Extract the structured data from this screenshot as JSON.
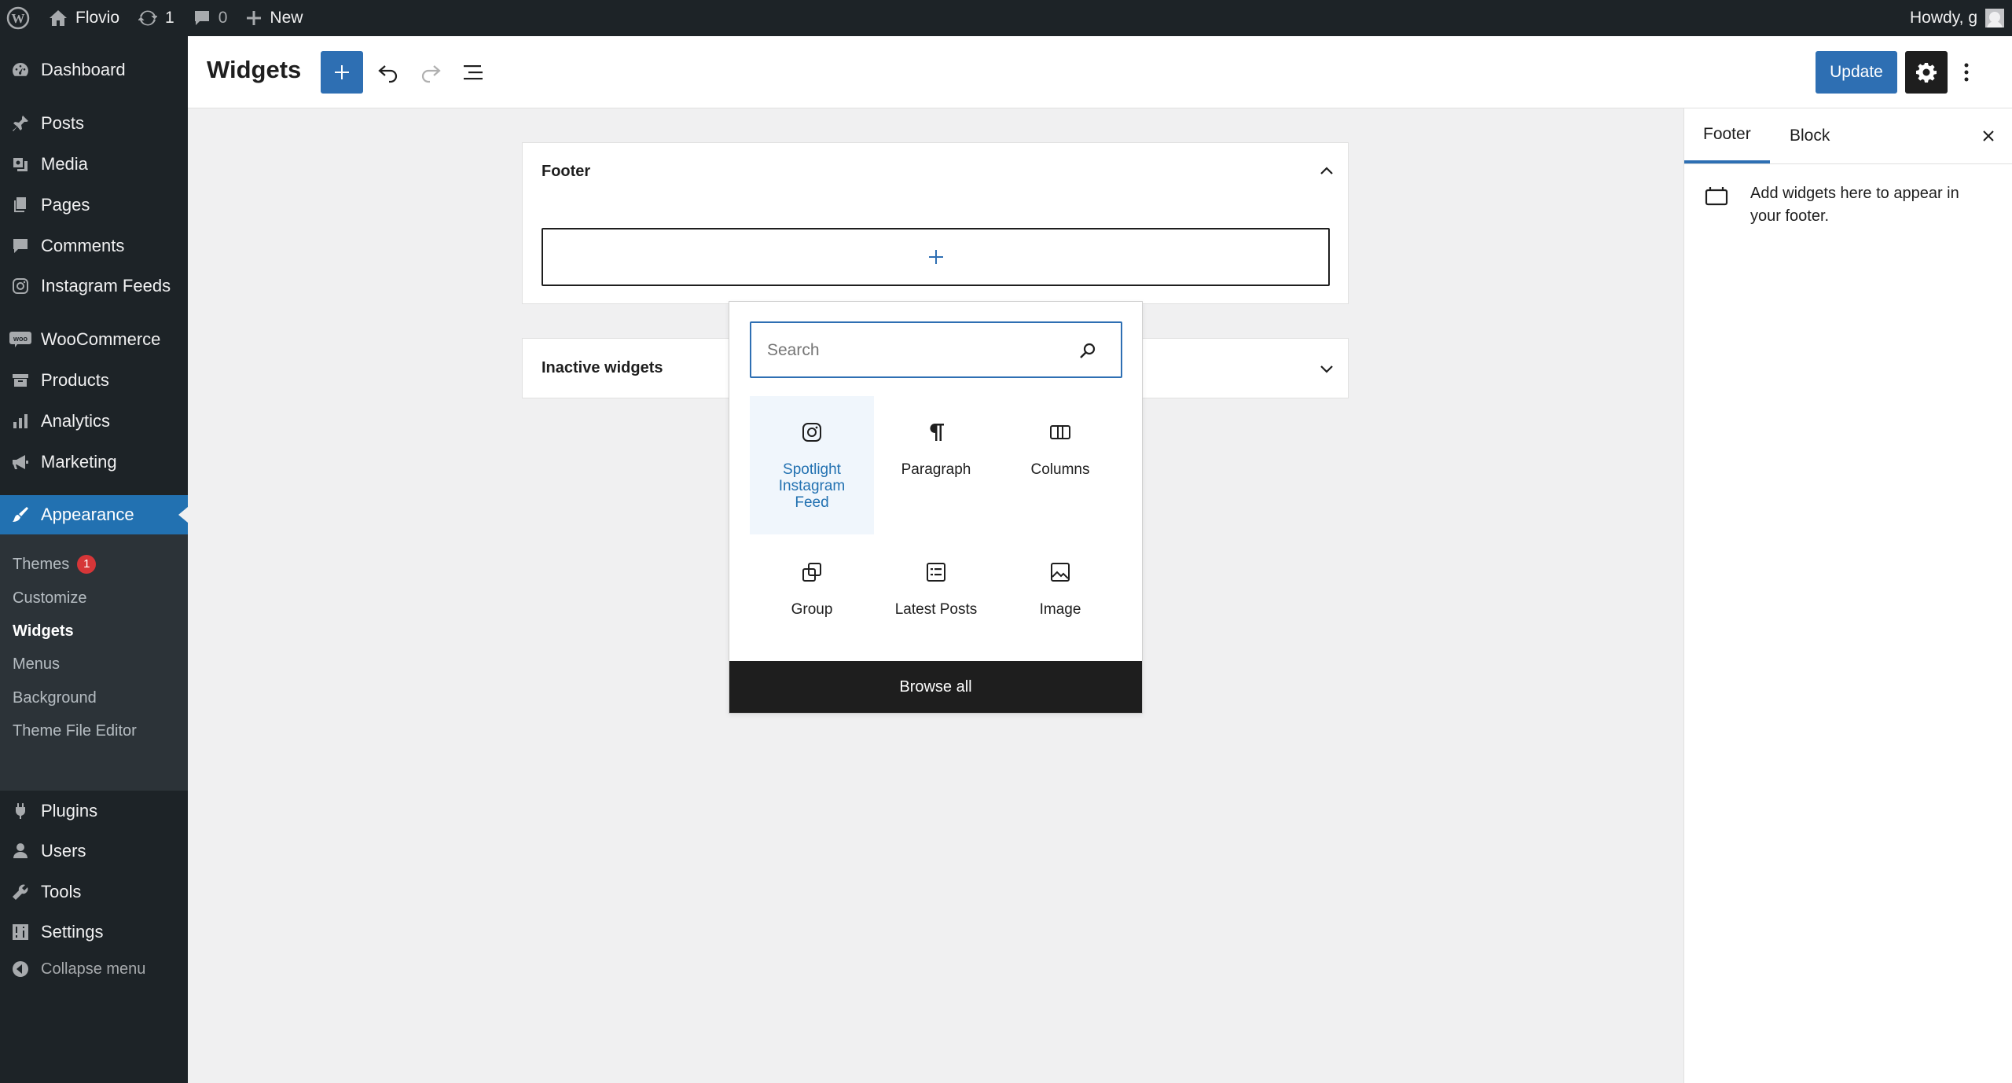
{
  "adminbar": {
    "site_name": "Flovio",
    "updates_count": "1",
    "comments_count": "0",
    "new_label": "New",
    "howdy": "Howdy, g"
  },
  "sidebar": {
    "items": [
      {
        "label": "Dashboard",
        "icon": "dashboard-icon"
      },
      {
        "label": "Posts",
        "icon": "pin-icon"
      },
      {
        "label": "Media",
        "icon": "media-icon"
      },
      {
        "label": "Pages",
        "icon": "pages-icon"
      },
      {
        "label": "Comments",
        "icon": "comment-icon"
      },
      {
        "label": "Instagram Feeds",
        "icon": "instagram-icon"
      },
      {
        "label": "WooCommerce",
        "icon": "woo-icon"
      },
      {
        "label": "Products",
        "icon": "archive-icon"
      },
      {
        "label": "Analytics",
        "icon": "chart-icon"
      },
      {
        "label": "Marketing",
        "icon": "megaphone-icon"
      },
      {
        "label": "Appearance",
        "icon": "brush-icon"
      },
      {
        "label": "Plugins",
        "icon": "plugin-icon"
      },
      {
        "label": "Users",
        "icon": "user-icon"
      },
      {
        "label": "Tools",
        "icon": "wrench-icon"
      },
      {
        "label": "Settings",
        "icon": "settings-icon"
      },
      {
        "label": "Collapse menu",
        "icon": "collapse-icon"
      }
    ],
    "submenu": [
      {
        "label": "Themes",
        "badge": "1"
      },
      {
        "label": "Customize"
      },
      {
        "label": "Widgets"
      },
      {
        "label": "Menus"
      },
      {
        "label": "Background"
      },
      {
        "label": "Theme File Editor"
      }
    ]
  },
  "header": {
    "title": "Widgets",
    "update_label": "Update"
  },
  "canvas": {
    "footer_title": "Footer",
    "inactive_title": "Inactive widgets"
  },
  "inserter": {
    "search_placeholder": "Search",
    "blocks": [
      {
        "label": "Spotlight Instagram Feed",
        "icon": "instagram-icon"
      },
      {
        "label": "Paragraph",
        "icon": "paragraph-icon"
      },
      {
        "label": "Columns",
        "icon": "columns-icon"
      },
      {
        "label": "Group",
        "icon": "group-icon"
      },
      {
        "label": "Latest Posts",
        "icon": "latest-posts-icon"
      },
      {
        "label": "Image",
        "icon": "image-icon"
      }
    ],
    "browse_all": "Browse all"
  },
  "rpanel": {
    "tabs": [
      "Footer",
      "Block"
    ],
    "description": "Add widgets here to appear in your footer."
  },
  "colors": {
    "accent": "#2271b1",
    "admin_dark": "#1d2327",
    "badge": "#d63638"
  }
}
